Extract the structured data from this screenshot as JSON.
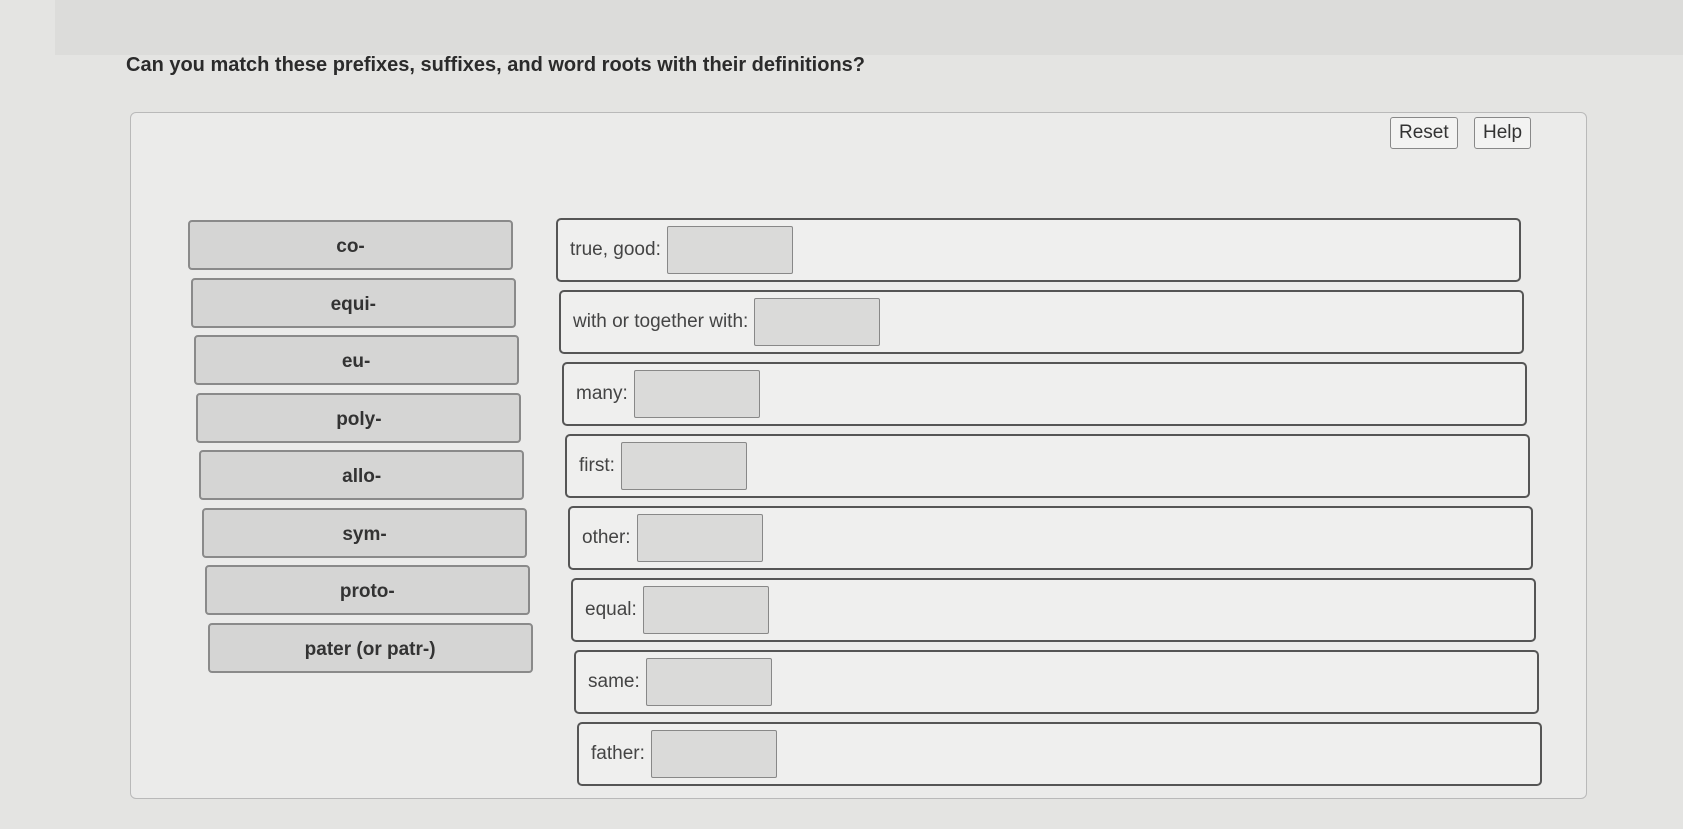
{
  "question": "Can you match these prefixes, suffixes, and word roots with their definitions?",
  "buttons": {
    "reset": "Reset",
    "help": "Help"
  },
  "tiles": [
    "co-",
    "equi-",
    "eu-",
    "poly-",
    "allo-",
    "sym-",
    "proto-",
    "pater (or patr-)"
  ],
  "definitions": [
    "true, good:",
    "with or together with:",
    "many:",
    "first:",
    "other:",
    "equal:",
    "same:",
    "father:"
  ]
}
